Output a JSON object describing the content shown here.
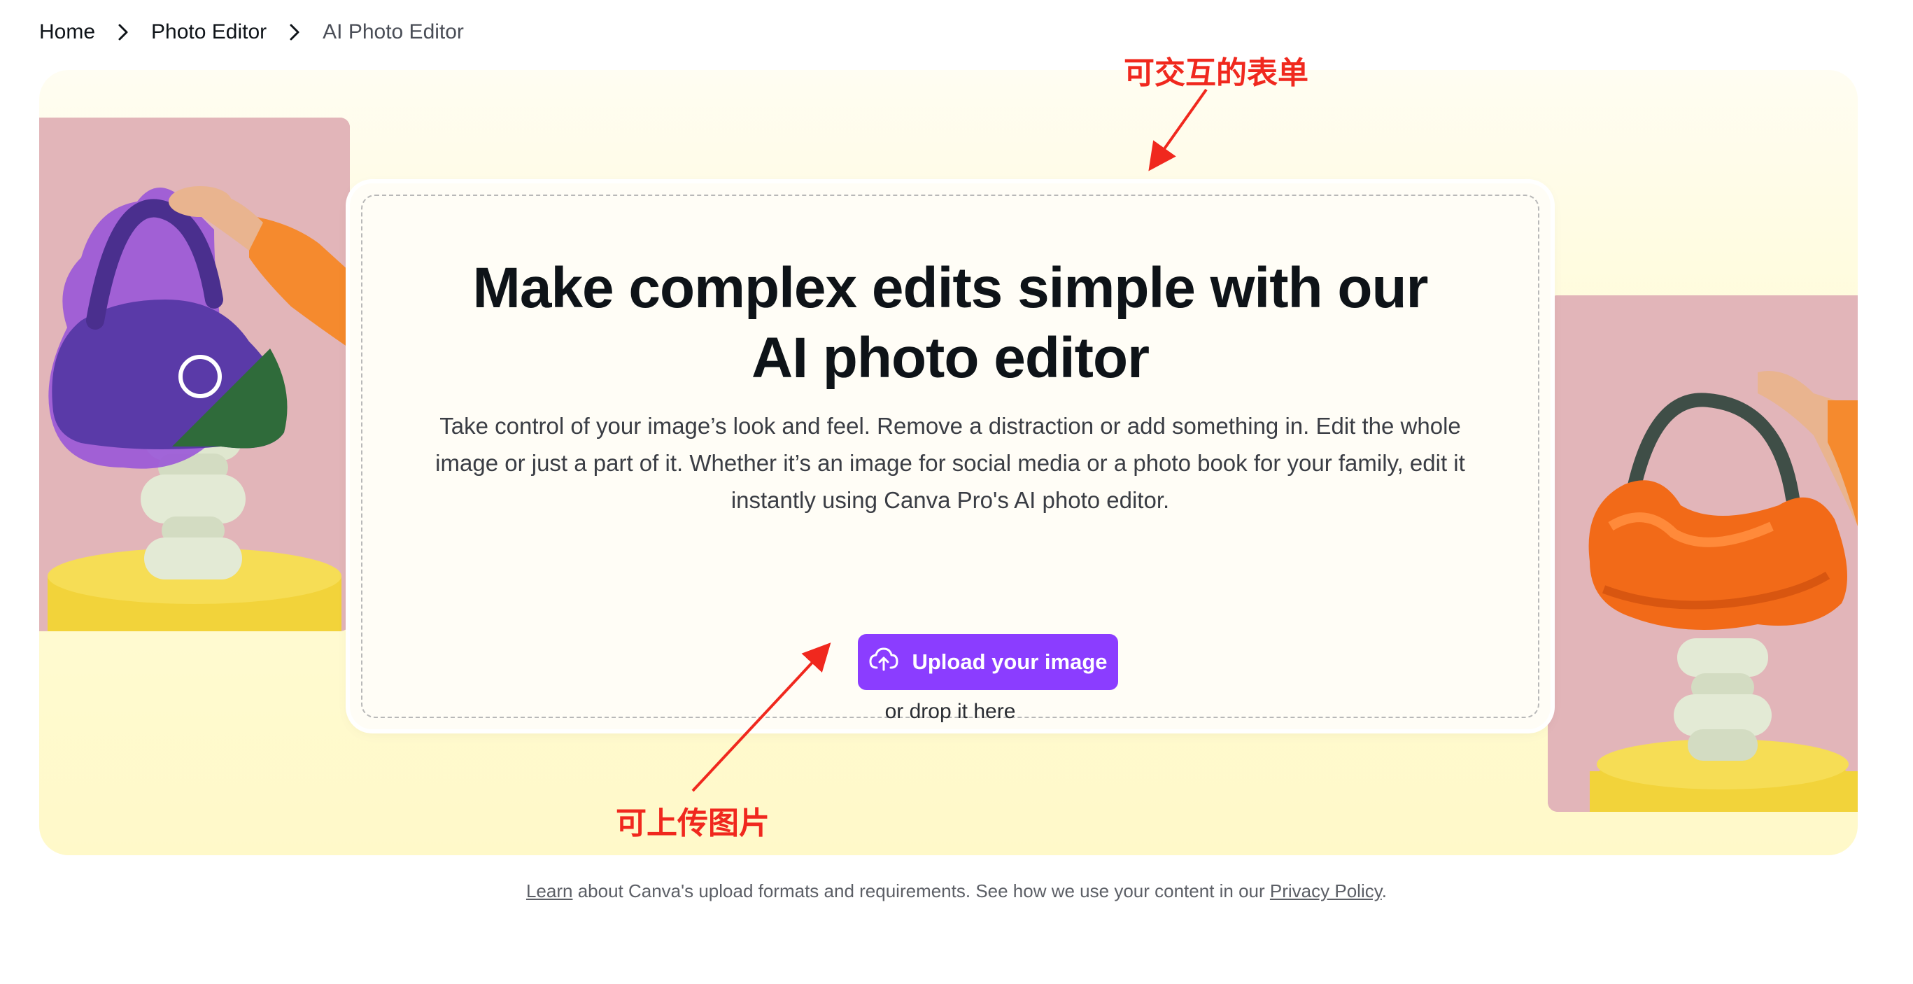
{
  "breadcrumb": {
    "items": [
      {
        "label": "Home"
      },
      {
        "label": "Photo Editor"
      },
      {
        "label": "AI Photo Editor"
      }
    ]
  },
  "hero": {
    "title_line1": "Make complex edits simple with our",
    "title_line2": "AI photo editor",
    "description": "Take control of your image’s look and feel. Remove a distraction or add something in. Edit the whole image or just a part of it. Whether it’s an image for social media or a photo book for your family, edit it instantly using Canva Pro's AI photo editor.",
    "upload_label": "Upload your image",
    "upload_icon": "cloud-upload-icon",
    "drop_text": "or drop it here"
  },
  "annotations": {
    "top": "可交互的表单",
    "bottom": "可上传图片"
  },
  "footer": {
    "learn_link": "Learn",
    "text_middle": " about Canva's upload formats and requirements. See how we use your content in our ",
    "privacy_link": "Privacy Policy",
    "text_end": "."
  },
  "colors": {
    "brand_purple": "#8b3dff",
    "annotation_red": "#f0281e",
    "hero_bg": "#fff9c9",
    "image_bg": "#e2b5b9"
  }
}
